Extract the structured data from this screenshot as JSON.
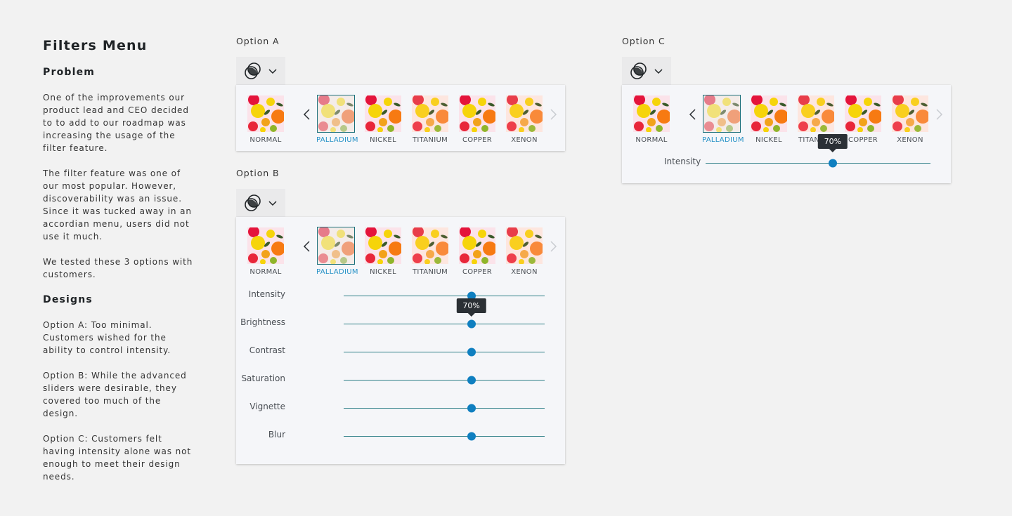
{
  "left": {
    "title": "Filters Menu",
    "problem_heading": "Problem",
    "problem_p1": "One of the improvements our product lead and CEO decided to to add to our roadmap was increasing the usage of the filter feature.",
    "problem_p2": "The filter feature was one of our most popular. However, discoverability was an issue. Since it was tucked away in an accordian menu, users did not use it much.",
    "problem_p3": "We tested these 3 options with customers.",
    "designs_heading": "Designs",
    "designs_p1": "Option A: Too minimal. Customers wished for the ability to control intensity.",
    "designs_p2": "Option B: While the advanced sliders were desirable, they covered too much of the design.",
    "designs_p3": "Option C: Customers felt having intensity alone was not enough to meet their design needs."
  },
  "filters": [
    "NORMAL",
    "PALLADIUM",
    "NICKEL",
    "TITANIUM",
    "COPPER",
    "XENON"
  ],
  "selected_filter": "PALLADIUM",
  "icons": {
    "trigger": "filter-circles-icon",
    "dropdown": "chevron-down-icon",
    "prev": "chevron-left-icon",
    "next": "chevron-right-icon"
  },
  "colors": {
    "accent": "#2591c6",
    "knob": "#0f7fc0",
    "track": "#2e7f87",
    "selected_border": "#1b6f7a",
    "tooltip_bg": "#2b3035"
  },
  "option_a": {
    "label": "Option A"
  },
  "option_b": {
    "label": "Option B",
    "sliders": [
      {
        "label": "Intensity",
        "value": 0.635
      },
      {
        "label": "Brightness",
        "value": 0.635,
        "tooltip": "70%"
      },
      {
        "label": "Contrast",
        "value": 0.635
      },
      {
        "label": "Saturation",
        "value": 0.635
      },
      {
        "label": "Vignette",
        "value": 0.635
      },
      {
        "label": "Blur",
        "value": 0.635
      }
    ]
  },
  "option_c": {
    "label": "Option C",
    "slider": {
      "label": "Intensity",
      "value": 0.565,
      "tooltip": "70%"
    }
  }
}
